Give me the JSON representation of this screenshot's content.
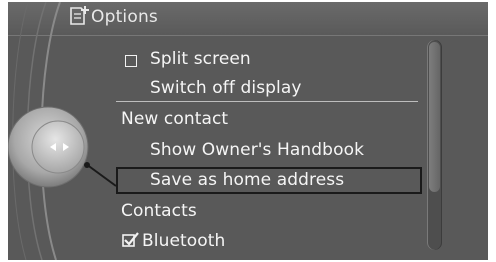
{
  "header": {
    "title": "Options",
    "icon": "menu-options-icon"
  },
  "menu": {
    "items": [
      {
        "label": "Split screen",
        "checkbox": true,
        "checked": false
      },
      {
        "label": "Switch off display"
      },
      {
        "label": "New contact"
      },
      {
        "label": "Show Owner's Handbook"
      },
      {
        "label": "Save as home address",
        "selected": true
      },
      {
        "label": "Contacts"
      },
      {
        "label": "Bluetooth",
        "checkbox": true,
        "checked": true
      }
    ]
  },
  "controller": {
    "icon": "controller-knob-icon"
  },
  "colors": {
    "background": "#595959",
    "text": "#f5f5f5",
    "selection_border": "#1a1a1a"
  }
}
